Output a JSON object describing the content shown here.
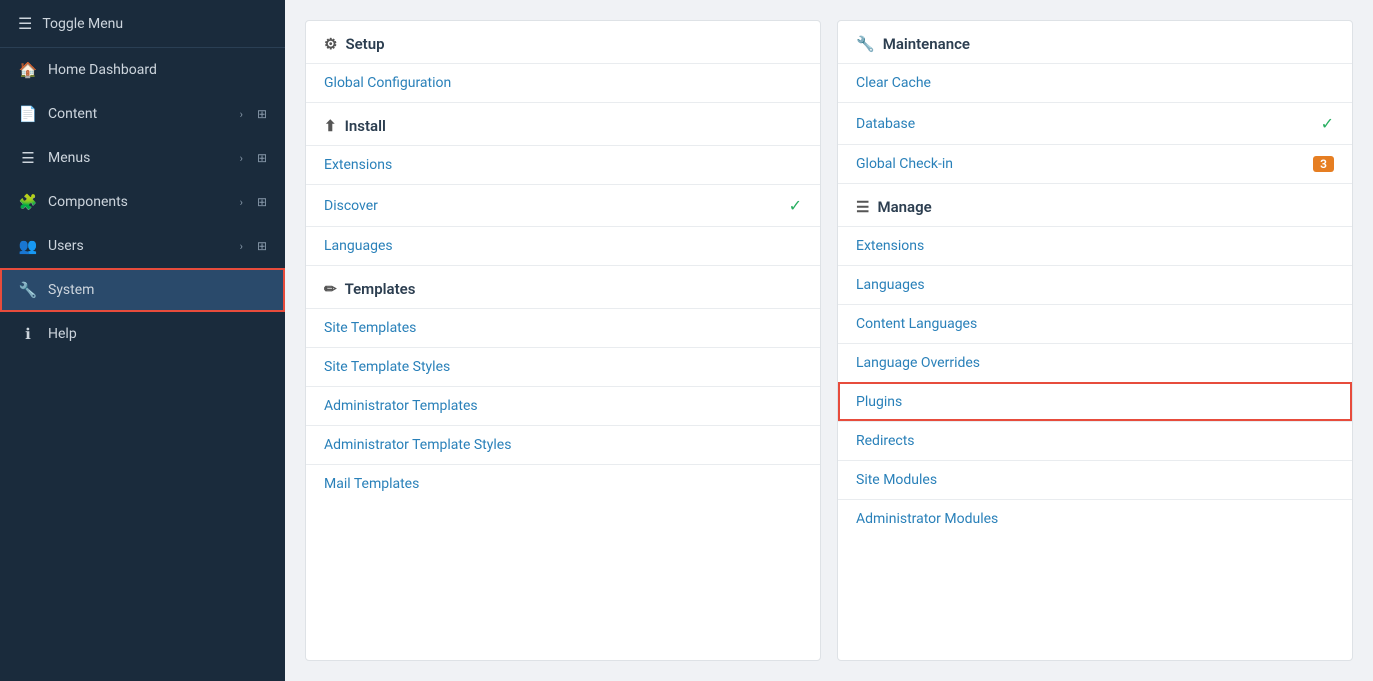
{
  "sidebar": {
    "toggle_label": "Toggle Menu",
    "items": [
      {
        "id": "home-dashboard",
        "label": "Home Dashboard",
        "icon": "🏠",
        "chevron": false,
        "grid": false,
        "active": false
      },
      {
        "id": "content",
        "label": "Content",
        "icon": "📄",
        "chevron": true,
        "grid": true,
        "active": false
      },
      {
        "id": "menus",
        "label": "Menus",
        "icon": "☰",
        "chevron": true,
        "grid": true,
        "active": false
      },
      {
        "id": "components",
        "label": "Components",
        "icon": "🧩",
        "chevron": true,
        "grid": true,
        "active": false
      },
      {
        "id": "users",
        "label": "Users",
        "icon": "👥",
        "chevron": true,
        "grid": true,
        "active": false
      },
      {
        "id": "system",
        "label": "System",
        "icon": "🔧",
        "chevron": false,
        "grid": false,
        "active": true
      },
      {
        "id": "help",
        "label": "Help",
        "icon": "ℹ",
        "chevron": false,
        "grid": false,
        "active": false
      }
    ]
  },
  "left_panel": {
    "sections": [
      {
        "id": "setup",
        "icon": "⚙",
        "header": "Setup",
        "links": [
          {
            "id": "global-configuration",
            "label": "Global Configuration",
            "check": false,
            "badge": null
          }
        ]
      },
      {
        "id": "install",
        "icon": "⬆",
        "header": "Install",
        "links": [
          {
            "id": "extensions-install",
            "label": "Extensions",
            "check": false,
            "badge": null
          },
          {
            "id": "discover",
            "label": "Discover",
            "check": true,
            "badge": null
          },
          {
            "id": "languages",
            "label": "Languages",
            "check": false,
            "badge": null
          }
        ]
      },
      {
        "id": "templates",
        "icon": "✏",
        "header": "Templates",
        "links": [
          {
            "id": "site-templates",
            "label": "Site Templates",
            "check": false,
            "badge": null
          },
          {
            "id": "site-template-styles",
            "label": "Site Template Styles",
            "check": false,
            "badge": null
          },
          {
            "id": "administrator-templates",
            "label": "Administrator Templates",
            "check": false,
            "badge": null
          },
          {
            "id": "administrator-template-styles",
            "label": "Administrator Template Styles",
            "check": false,
            "badge": null
          },
          {
            "id": "mail-templates",
            "label": "Mail Templates",
            "check": false,
            "badge": null
          }
        ]
      }
    ]
  },
  "right_panel": {
    "sections": [
      {
        "id": "maintenance",
        "icon": "🔧",
        "header": "Maintenance",
        "links": [
          {
            "id": "clear-cache",
            "label": "Clear Cache",
            "check": false,
            "badge": null,
            "highlighted": false
          },
          {
            "id": "database",
            "label": "Database",
            "check": true,
            "badge": null,
            "highlighted": false
          },
          {
            "id": "global-check-in",
            "label": "Global Check-in",
            "check": false,
            "badge": "3",
            "highlighted": false
          }
        ]
      },
      {
        "id": "manage",
        "icon": "☰",
        "header": "Manage",
        "links": [
          {
            "id": "extensions-manage",
            "label": "Extensions",
            "check": false,
            "badge": null,
            "highlighted": false
          },
          {
            "id": "languages-manage",
            "label": "Languages",
            "check": false,
            "badge": null,
            "highlighted": false
          },
          {
            "id": "content-languages",
            "label": "Content Languages",
            "check": false,
            "badge": null,
            "highlighted": false
          },
          {
            "id": "language-overrides",
            "label": "Language Overrides",
            "check": false,
            "badge": null,
            "highlighted": false
          },
          {
            "id": "plugins",
            "label": "Plugins",
            "check": false,
            "badge": null,
            "highlighted": true
          },
          {
            "id": "redirects",
            "label": "Redirects",
            "check": false,
            "badge": null,
            "highlighted": false
          },
          {
            "id": "site-modules",
            "label": "Site Modules",
            "check": false,
            "badge": null,
            "highlighted": false
          },
          {
            "id": "administrator-modules",
            "label": "Administrator Modules",
            "check": false,
            "badge": null,
            "highlighted": false
          }
        ]
      }
    ]
  }
}
